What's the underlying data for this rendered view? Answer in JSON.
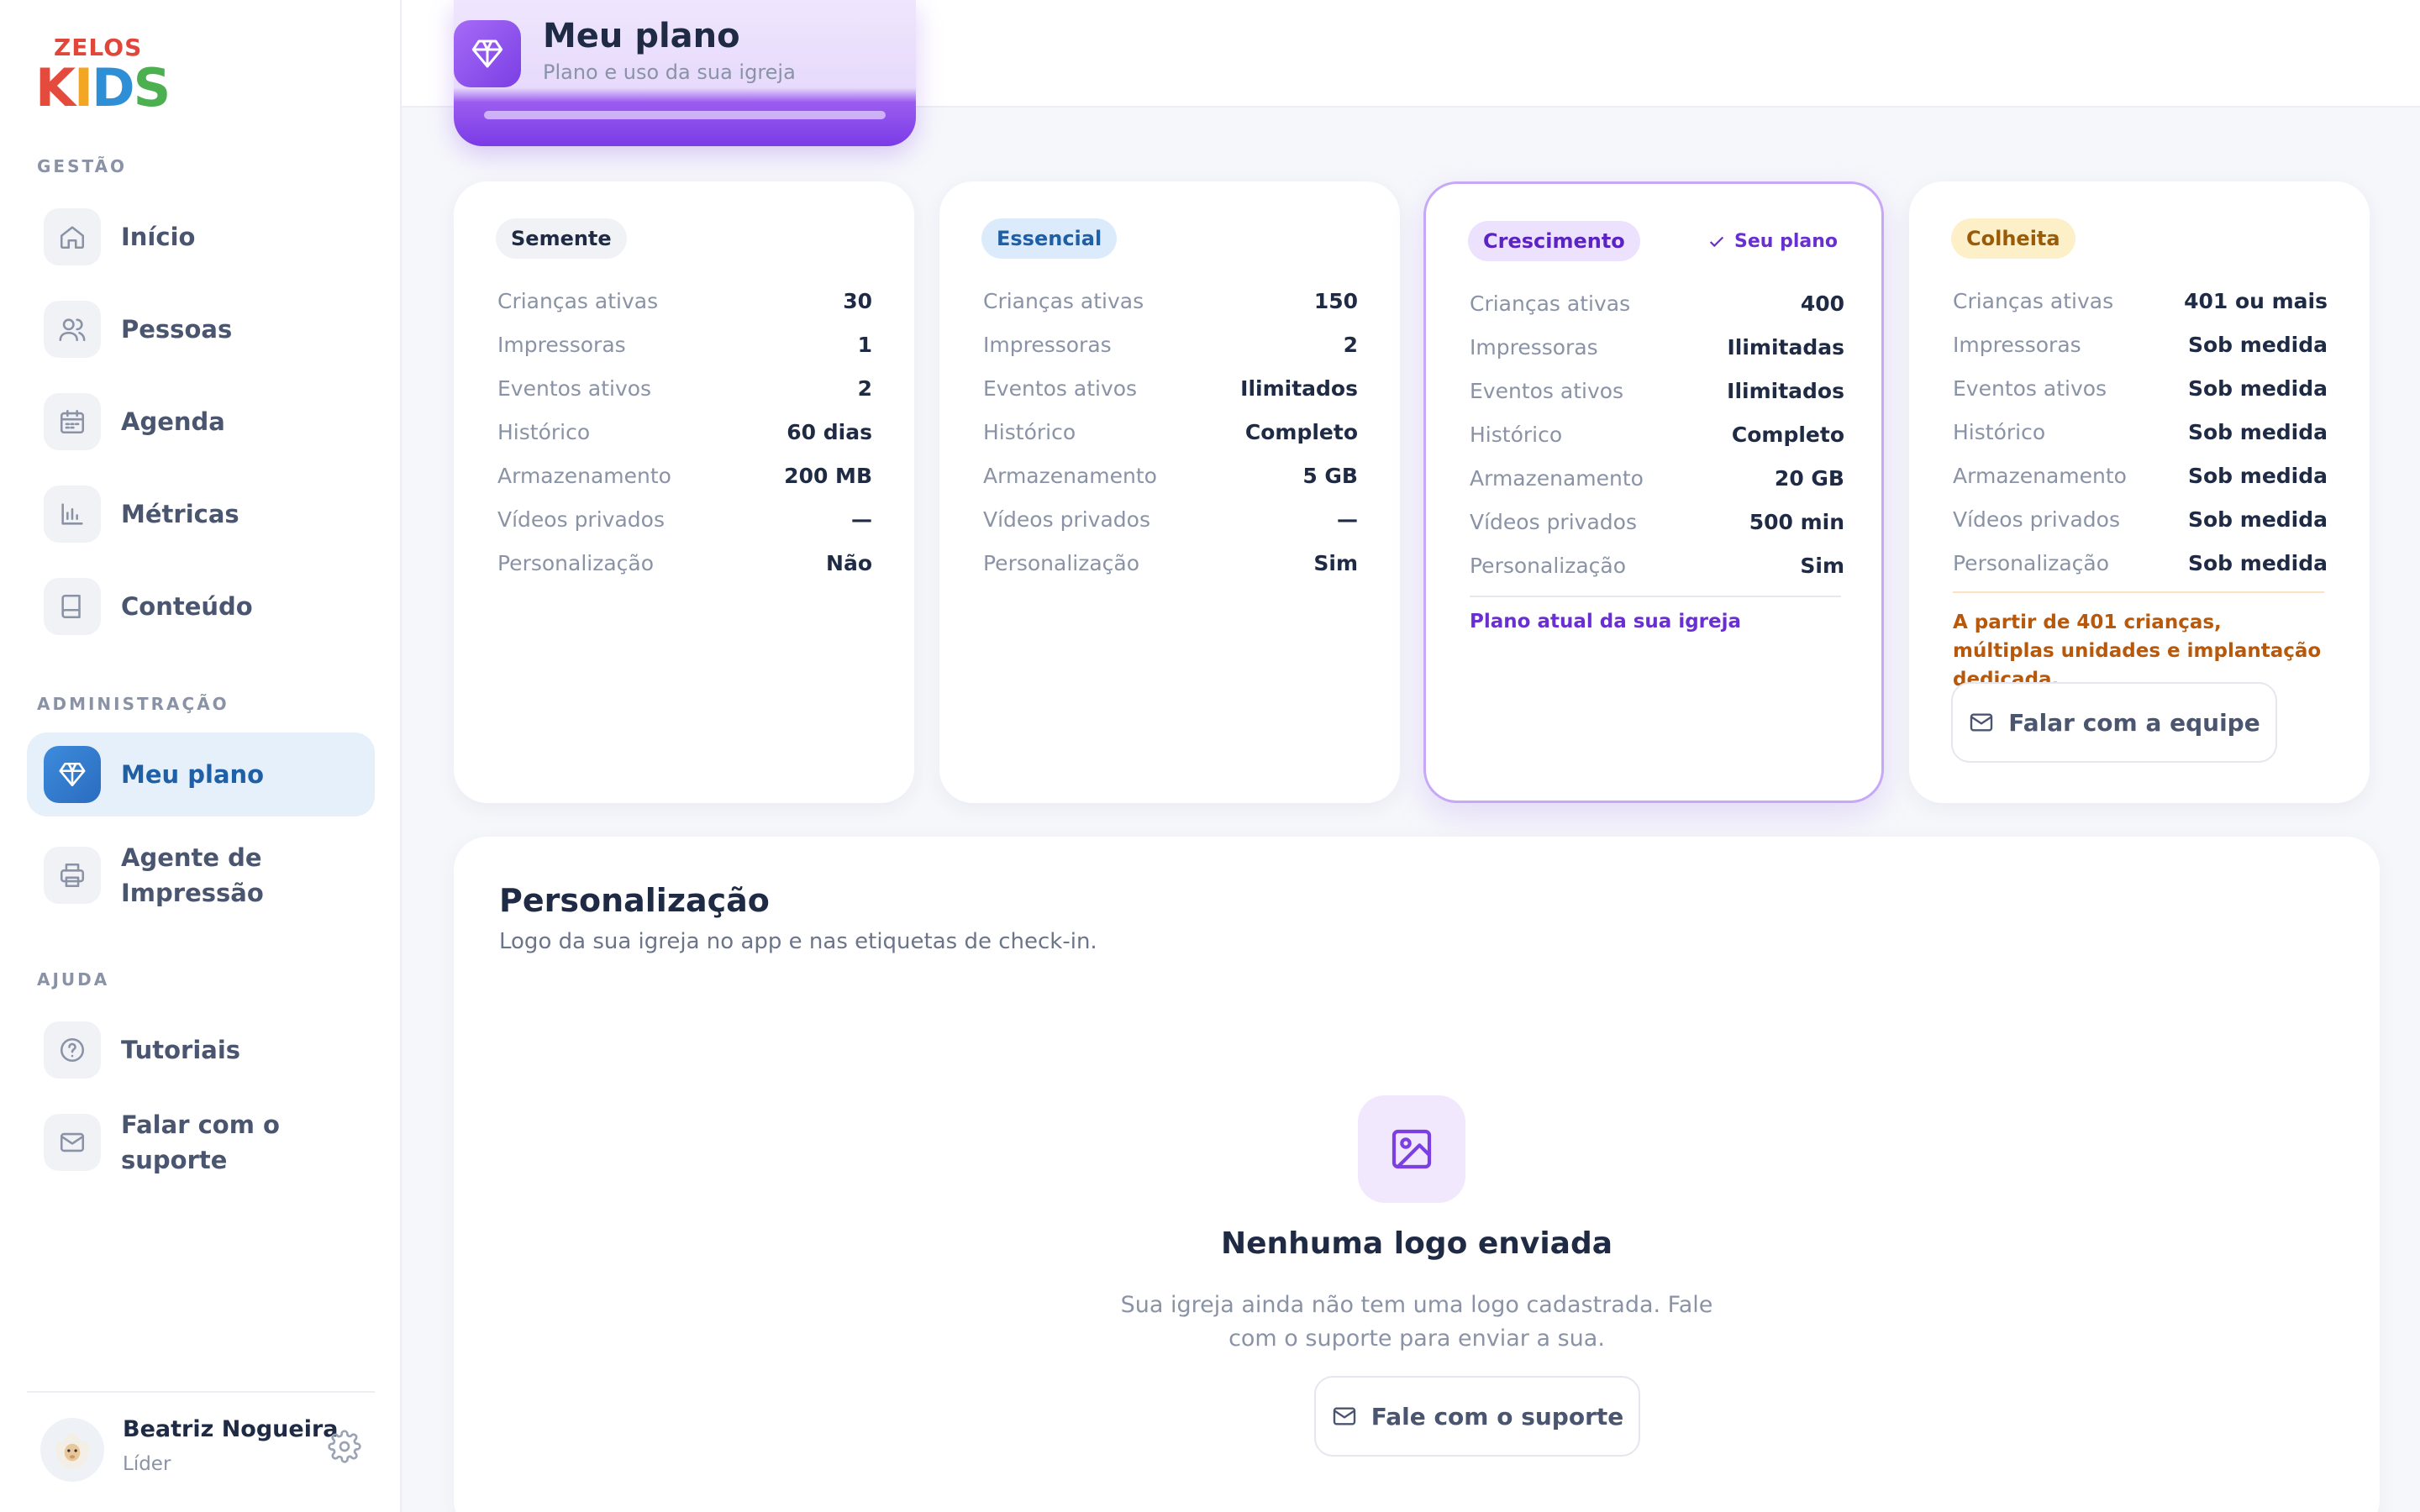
{
  "brand": {
    "line1": "ZELOS",
    "line2": "KIDS"
  },
  "sidebar": {
    "sections": [
      "GESTÃO",
      "ADMINISTRAÇÃO",
      "AJUDA"
    ],
    "items": [
      {
        "label": "Início",
        "icon": "home-icon"
      },
      {
        "label": "Pessoas",
        "icon": "users-icon"
      },
      {
        "label": "Agenda",
        "icon": "calendar-icon"
      },
      {
        "label": "Métricas",
        "icon": "bar-chart-icon"
      },
      {
        "label": "Conteúdo",
        "icon": "book-icon"
      },
      {
        "label": "Meu plano",
        "icon": "diamond-icon",
        "active": true
      },
      {
        "label": "Agente de Impressão",
        "icon": "printer-icon"
      },
      {
        "label": "Tutoriais",
        "icon": "help-circle-icon"
      },
      {
        "label": "Falar com o suporte",
        "icon": "mail-icon"
      }
    ]
  },
  "user": {
    "name": "Beatriz Nogueira",
    "role": "Líder"
  },
  "header": {
    "title": "Meu plano",
    "subtitle": "Plano e uso da sua igreja"
  },
  "row_labels": [
    "Crianças ativas",
    "Impressoras",
    "Eventos ativos",
    "Histórico",
    "Armazenamento",
    "Vídeos privados",
    "Personalização"
  ],
  "plans": [
    {
      "name": "Semente",
      "values": [
        "30",
        "1",
        "2",
        "60 dias",
        "200 MB",
        "—",
        "Não"
      ],
      "badge_bg": "#f1f2f6",
      "badge_fg": "#1f2a44"
    },
    {
      "name": "Essencial",
      "values": [
        "150",
        "2",
        "Ilimitados",
        "Completo",
        "5 GB",
        "—",
        "Sim"
      ],
      "badge_bg": "#dcebfb",
      "badge_fg": "#1f5fa6"
    },
    {
      "name": "Crescimento",
      "values": [
        "400",
        "Ilimitadas",
        "Ilimitados",
        "Completo",
        "20 GB",
        "500 min",
        "Sim"
      ],
      "badge_bg": "#ece2fd",
      "badge_fg": "#5b23c2",
      "current_label": "Seu plano",
      "note": "Plano atual da sua igreja"
    },
    {
      "name": "Colheita",
      "values": [
        "401 ou mais",
        "Sob medida",
        "Sob medida",
        "Sob medida",
        "Sob medida",
        "Sob medida",
        "Sob medida"
      ],
      "badge_bg": "#fdf0c9",
      "badge_fg": "#9a5a06",
      "note": "A partir de 401 crianças, múltiplas unidades e implantação dedicada.",
      "button": "Falar com a equipe"
    }
  ],
  "personalization": {
    "title": "Personalização",
    "subtitle": "Logo da sua igreja no app e nas etiquetas de check-in.",
    "empty_title": "Nenhuma logo enviada",
    "empty_text": "Sua igreja ainda não tem uma logo cadastrada. Fale com o suporte para enviar a sua.",
    "button": "Fale com o suporte"
  },
  "colors": {
    "accent": "#7b3fe4",
    "nav_active": "#1f5fa6"
  }
}
